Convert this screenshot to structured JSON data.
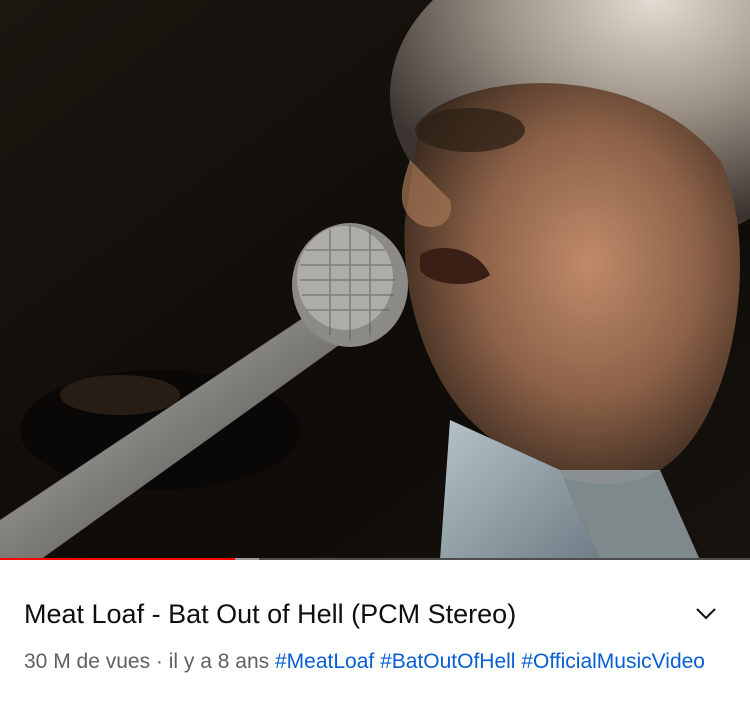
{
  "video": {
    "progress_fraction": 0.313,
    "buffered_fraction": 0.345,
    "progress_color": "#ff0000"
  },
  "title": "Meat Loaf - Bat Out of Hell (PCM Stereo)",
  "expand_icon": "chevron-down-icon",
  "meta": {
    "views": "30 M de vues",
    "separator": " · ",
    "age": "il y a 8 ans"
  },
  "hashtags": [
    "#MeatLoaf",
    "#BatOutOfHell",
    "#OfficialMusicVideo"
  ],
  "colors": {
    "title": "#0f0f0f",
    "meta": "#606060",
    "hashtag": "#065fd4"
  }
}
